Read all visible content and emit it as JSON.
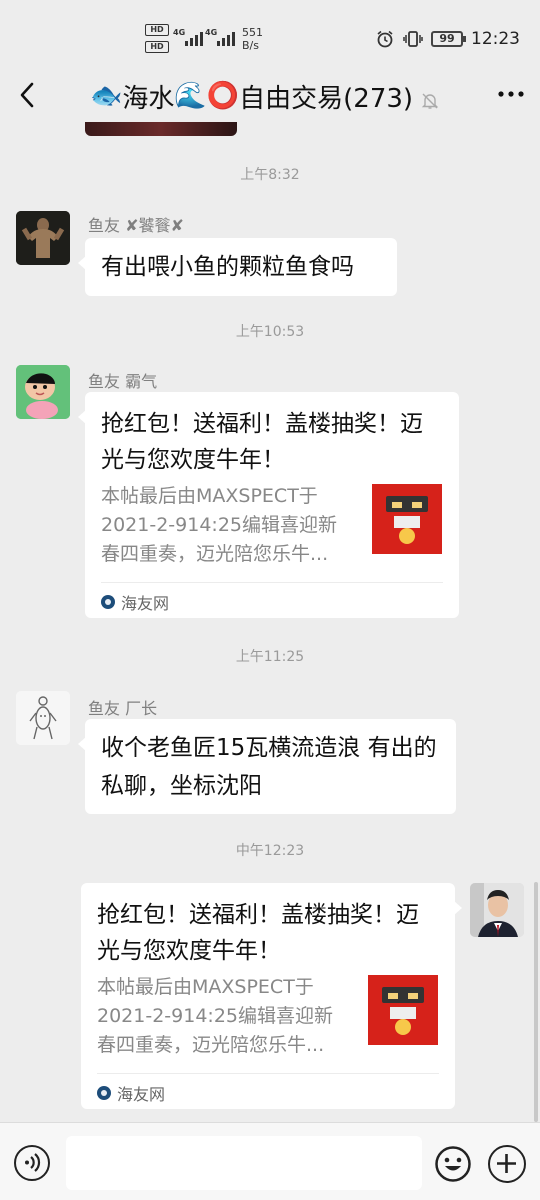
{
  "status_bar": {
    "hd1": "HD",
    "hd2": "HD",
    "net1": "4G",
    "net2": "4G",
    "speed_value": "551",
    "speed_unit": "B/s",
    "battery": "99",
    "time": "12:23"
  },
  "nav": {
    "title_icon1": "🐟",
    "title_part1": "海水",
    "title_icon2": "🌊",
    "title_icon3": "⭕",
    "title_part2": "自由交易(273)"
  },
  "messages": [
    {
      "time": "上午8:32",
      "sender": "鱼友 ✘饕餮✘",
      "text": "有出喂小鱼的颗粒鱼食吗"
    },
    {
      "time": "上午10:53",
      "sender": "鱼友 霸气",
      "card": {
        "title": "抢红包！送福利！盖楼抽奖！迈光与您欢度牛年！",
        "desc": "本帖最后由MAXSPECT于2021-2-914:25编辑喜迎新春四重奏，迈光陪您乐牛...",
        "source": "海友网"
      }
    },
    {
      "time": "上午11:25",
      "sender": "鱼友 厂长",
      "text": "收个老鱼匠15瓦横流造浪 有出的私聊，坐标沈阳"
    },
    {
      "time": "中午12:23",
      "card": {
        "title": "抢红包！送福利！盖楼抽奖！迈光与您欢度牛年！",
        "desc": "本帖最后由MAXSPECT于2021-2-914:25编辑喜迎新春四重奏，迈光陪您乐牛...",
        "source": "海友网"
      }
    }
  ],
  "input": {
    "placeholder": ""
  },
  "icons": {
    "back": "back-arrow-icon",
    "mute": "mute-bell-icon",
    "more": "more-icon",
    "voice": "voice-icon",
    "emoji": "emoji-icon",
    "plus": "plus-icon"
  }
}
